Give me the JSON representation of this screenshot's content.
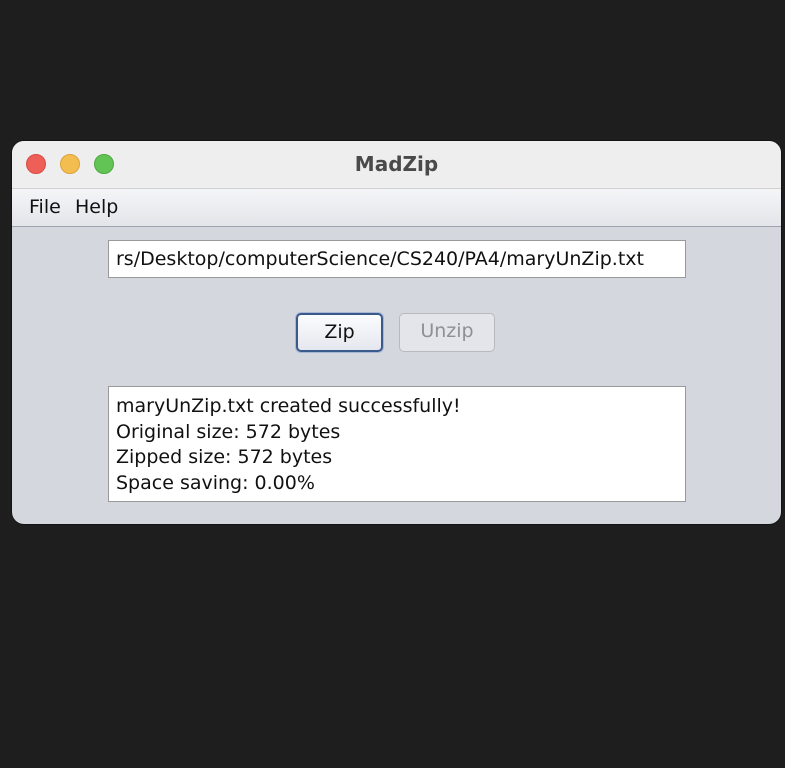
{
  "window": {
    "title": "MadZip"
  },
  "menu": {
    "file": "File",
    "help": "Help"
  },
  "path_field": {
    "value": "rs/Desktop/computerScience/CS240/PA4/maryUnZip.txt"
  },
  "buttons": {
    "zip": "Zip",
    "unzip": "Unzip"
  },
  "output": {
    "lines": [
      "maryUnZip.txt created successfully!",
      "Original size: 572 bytes",
      "Zipped size: 572 bytes",
      "Space saving: 0.00%"
    ]
  },
  "colors": {
    "traffic_close": "#ee5f57",
    "traffic_minimize": "#f4bd4f",
    "traffic_maximize": "#61c454",
    "window_bg": "#d5d7de",
    "focus_ring": "#3a5a8c"
  }
}
